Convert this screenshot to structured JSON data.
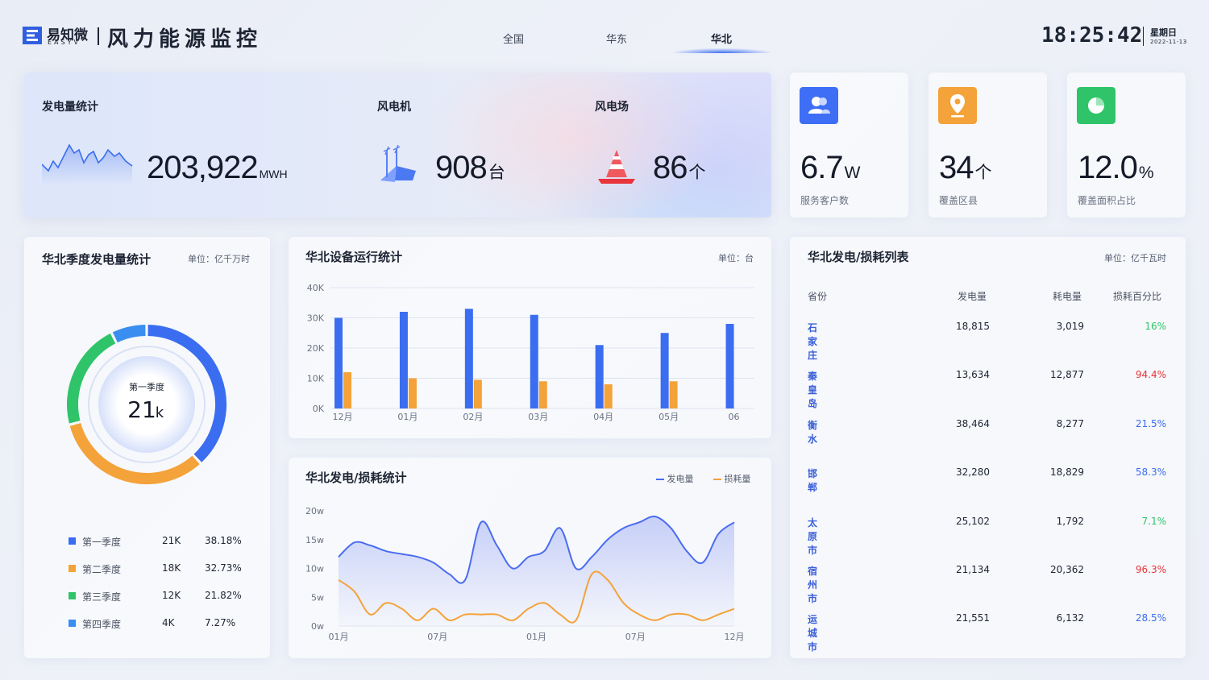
{
  "header": {
    "logo_text": "易知微",
    "logo_sub": "EASYV",
    "title": "风力能源监控",
    "tabs": [
      {
        "label": "全国",
        "active": false
      },
      {
        "label": "华东",
        "active": false
      },
      {
        "label": "华北",
        "active": true
      }
    ],
    "time": "18:25:42",
    "weekday": "星期日",
    "date": "2022-11-13"
  },
  "stats": {
    "power": {
      "label": "发电量统计",
      "value": "203,922",
      "unit": "MWH"
    },
    "turbines": {
      "label": "风电机",
      "value": "908",
      "unit": "台"
    },
    "farms": {
      "label": "风电场",
      "value": "86",
      "unit": "个"
    }
  },
  "kpis": [
    {
      "value": "6.7",
      "unit": "W",
      "label": "服务客户数",
      "icon": "user-icon",
      "color": "#3d6ef5"
    },
    {
      "value": "34",
      "unit": "个",
      "label": "覆盖区县",
      "icon": "location-pin-icon",
      "color": "#f4a23a"
    },
    {
      "value": "12.0",
      "unit": "%",
      "label": "覆盖面积占比",
      "icon": "pie-chart-icon",
      "color": "#2fc46a"
    }
  ],
  "quarter_panel": {
    "title": "华北季度发电量统计",
    "unit": "单位：亿千万时",
    "center_label": "第一季度",
    "center_value": "21",
    "center_unit": "k"
  },
  "device_panel": {
    "title": "华北设备运行统计",
    "unit": "单位：台"
  },
  "loss_panel": {
    "title": "华北发电/损耗统计",
    "legend_power": "发电量",
    "legend_loss": "损耗量"
  },
  "table_panel": {
    "title": "华北发电/损耗列表",
    "unit": "单位：亿千瓦时",
    "headers": [
      "省份",
      "发电量",
      "耗电量",
      "损耗百分比"
    ],
    "rows": [
      {
        "province": "石家庄",
        "generation": "18,815",
        "consumption": "3,019",
        "percent": "16%",
        "color": "#2fc46a"
      },
      {
        "province": "秦皇岛",
        "generation": "13,634",
        "consumption": "12,877",
        "percent": "94.4%",
        "color": "#e8343a"
      },
      {
        "province": "衡水",
        "generation": "38,464",
        "consumption": "8,277",
        "percent": "21.5%",
        "color": "#3a6df0"
      },
      {
        "province": "邯郸",
        "generation": "32,280",
        "consumption": "18,829",
        "percent": "58.3%",
        "color": "#3a6df0"
      },
      {
        "province": "太原市",
        "generation": "25,102",
        "consumption": "1,792",
        "percent": "7.1%",
        "color": "#2fc46a"
      },
      {
        "province": "宿州市",
        "generation": "21,134",
        "consumption": "20,362",
        "percent": "96.3%",
        "color": "#e8343a"
      },
      {
        "province": "运城市",
        "generation": "21,551",
        "consumption": "6,132",
        "percent": "28.5%",
        "color": "#3a6df0"
      }
    ]
  },
  "chart_data": [
    {
      "type": "pie",
      "title": "华北季度发电量统计",
      "categories": [
        "第一季度",
        "第二季度",
        "第三季度",
        "第四季度"
      ],
      "labels": [
        "21K",
        "18K",
        "12K",
        "4K"
      ],
      "values": [
        38.18,
        32.73,
        21.82,
        7.27
      ],
      "percent_labels": [
        "38.18%",
        "32.73%",
        "21.82%",
        "7.27%"
      ],
      "colors": [
        "#3a6df0",
        "#f4a23a",
        "#2fc46a",
        "#3a8ef0"
      ]
    },
    {
      "type": "bar",
      "title": "华北设备运行统计",
      "categories": [
        "12月",
        "01月",
        "02月",
        "03月",
        "04月",
        "05月",
        "06"
      ],
      "series": [
        {
          "values": [
            30000,
            32000,
            33000,
            31000,
            21000,
            25000,
            28000
          ],
          "color": "#3a6df0"
        },
        {
          "values": [
            12000,
            10000,
            9500,
            9000,
            8000,
            9000,
            null
          ],
          "color": "#f4a23a"
        }
      ],
      "yticks": [
        "0K",
        "10K",
        "20K",
        "30K",
        "40K"
      ],
      "ylim": [
        0,
        40000
      ]
    },
    {
      "type": "area",
      "title": "华北发电/损耗统计",
      "xticks": [
        "01月",
        "07月",
        "01月",
        "07月",
        "12月"
      ],
      "yticks": [
        "0w",
        "5w",
        "10w",
        "15w",
        "20w"
      ],
      "ylim": [
        0,
        20
      ],
      "series": [
        {
          "name": "发电量",
          "color": "#4a6cf0",
          "values": [
            12,
            14.5,
            14,
            13,
            12.5,
            12,
            11,
            9,
            8,
            18,
            14,
            10,
            12,
            13,
            17,
            10,
            12,
            15,
            17,
            18,
            19,
            17,
            13,
            11,
            16,
            18
          ]
        },
        {
          "name": "损耗量",
          "color": "#f4a23a",
          "values": [
            8,
            6,
            2,
            4,
            3,
            1,
            3,
            1,
            2,
            2,
            2,
            1,
            3,
            4,
            2,
            1,
            9,
            8,
            4,
            2,
            1,
            2,
            2,
            1,
            2,
            3
          ]
        }
      ]
    }
  ]
}
